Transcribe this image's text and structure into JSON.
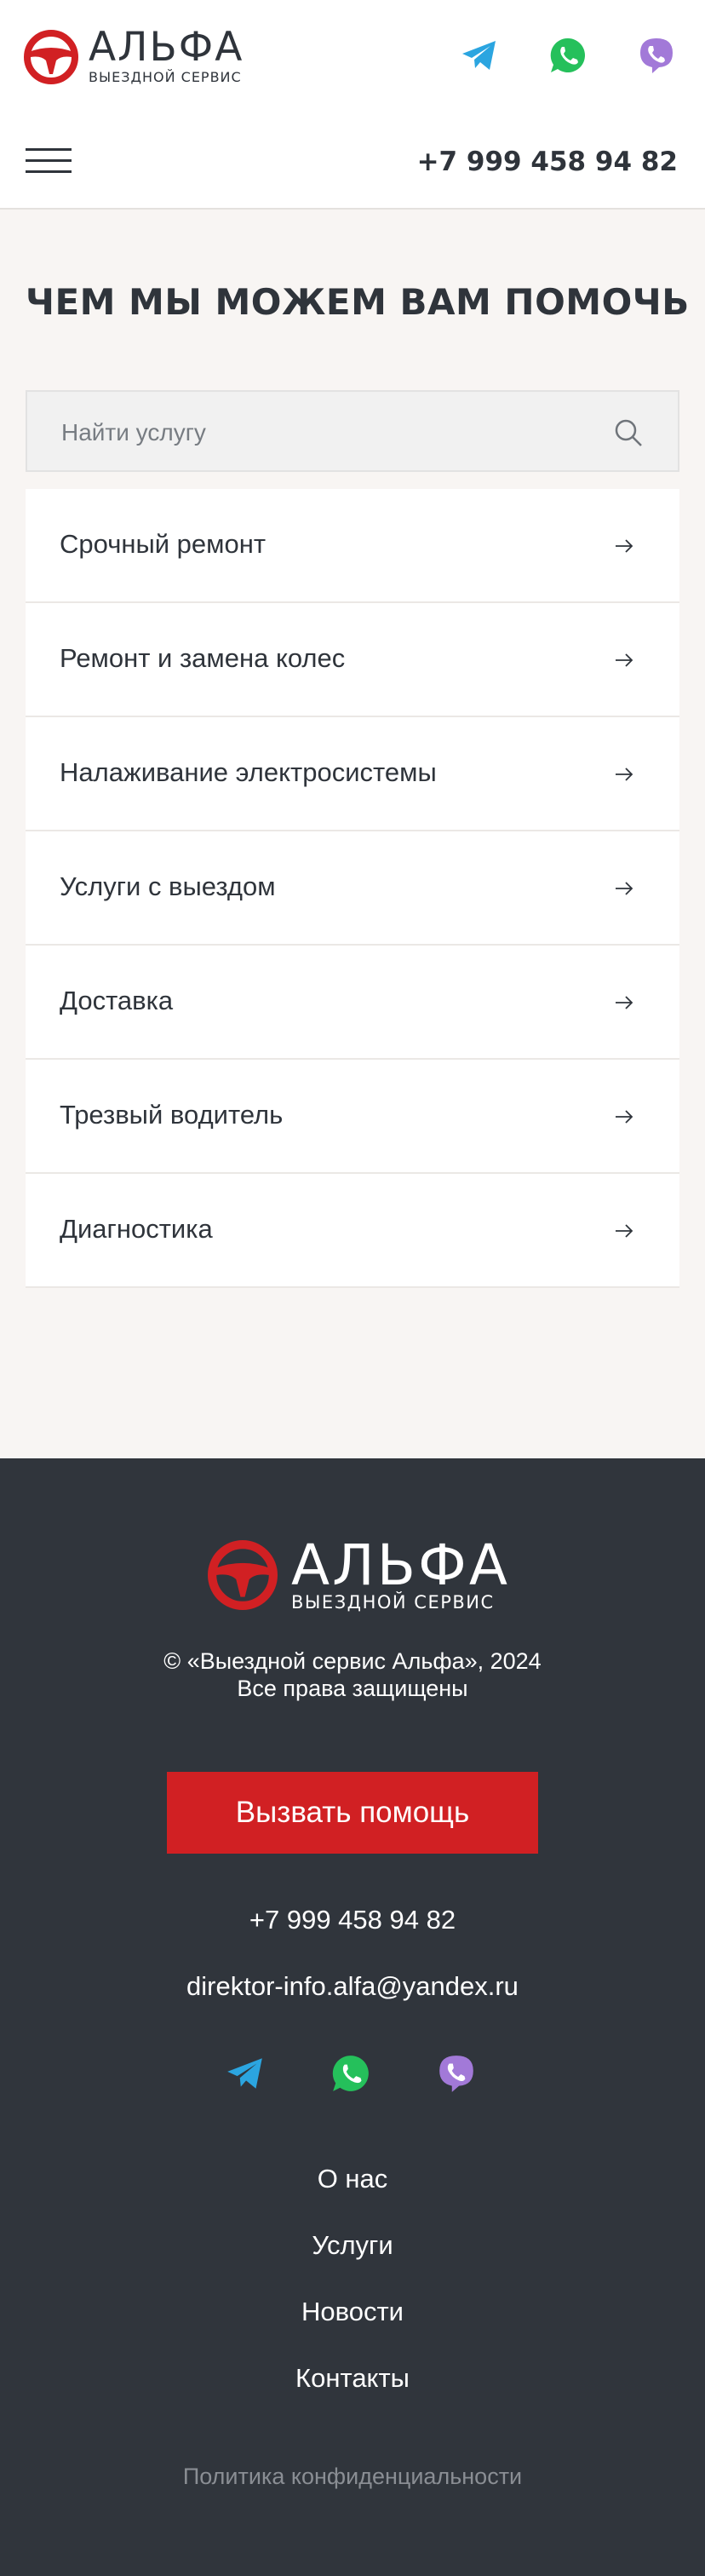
{
  "header": {
    "brand_name": "АЛЬФА",
    "brand_sub": "ВЫЕЗДНОЙ СЕРВИС",
    "phone": "+7 999 458 94 82",
    "messengers": [
      "telegram-icon",
      "whatsapp-icon",
      "viber-icon"
    ]
  },
  "main": {
    "title": "ЧЕМ МЫ МОЖЕМ ВАМ ПОМОЧЬ",
    "search_placeholder": "Найти услугу",
    "services": [
      "Срочный ремонт",
      "Ремонт и замена колес",
      "Налаживание электросистемы",
      "Услуги с выездом",
      "Доставка",
      "Трезвый водитель",
      "Диагностика"
    ]
  },
  "footer": {
    "brand_name": "АЛЬФА",
    "brand_sub": "ВЫЕЗДНОЙ СЕРВИС",
    "copyright": "© «Выездной сервис Альфа», 2024",
    "rights": "Все права защищены",
    "cta_label": "Вызвать помощь",
    "phone": "+7 999 458 94 82",
    "email": "direktor-info.alfa@yandex.ru",
    "nav": [
      "О нас",
      "Услуги",
      "Новости",
      "Контакты"
    ],
    "policy": "Политика конфиденциальности"
  },
  "colors": {
    "accent": "#d12023",
    "dark": "#30353c",
    "background": "#f8f5f3",
    "telegram": "#2ba5e0",
    "whatsapp": "#25c05b",
    "viber": "#a279d8"
  }
}
